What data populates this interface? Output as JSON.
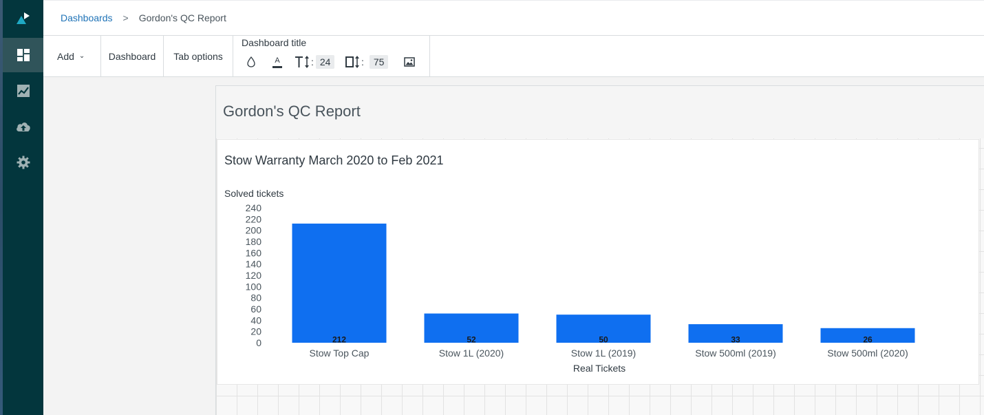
{
  "breadcrumb": {
    "root": "Dashboards",
    "separator": ">",
    "current": "Gordon's QC Report"
  },
  "toolbar": {
    "add_label": "Add",
    "dashboard_label": "Dashboard",
    "tab_options_label": "Tab options",
    "dashboard_title_label": "Dashboard title",
    "font_size_value": "24",
    "width_value": "75",
    "colon": ":"
  },
  "sidebar": {
    "items": [
      {
        "icon": "logo-icon"
      },
      {
        "icon": "dashboard-icon",
        "active": true
      },
      {
        "icon": "chart-icon"
      },
      {
        "icon": "upload-cloud-icon"
      },
      {
        "icon": "gear-icon"
      }
    ]
  },
  "dashboard": {
    "title": "Gordon's QC Report"
  },
  "widget": {
    "title": "Stow Warranty March 2020 to Feb 2021"
  },
  "colors": {
    "sidebar_bg": "#03363d",
    "bar": "#0f6ff0",
    "link": "#1f73b7"
  },
  "chart_data": {
    "type": "bar",
    "categories": [
      "Stow Top Cap",
      "Stow 1L (2020)",
      "Stow 1L (2019)",
      "Stow 500ml (2019)",
      "Stow 500ml (2020)"
    ],
    "values": [
      212,
      52,
      50,
      33,
      26
    ],
    "data_labels": [
      "212",
      "52",
      "50",
      "33",
      "26"
    ],
    "ylabel": "Solved tickets",
    "xlabel": "Real Tickets",
    "ylim": [
      0,
      240
    ],
    "yticks": [
      "0",
      "20",
      "40",
      "60",
      "80",
      "100",
      "120",
      "140",
      "160",
      "180",
      "200",
      "220",
      "240"
    ],
    "grid": false,
    "legend": "none"
  }
}
